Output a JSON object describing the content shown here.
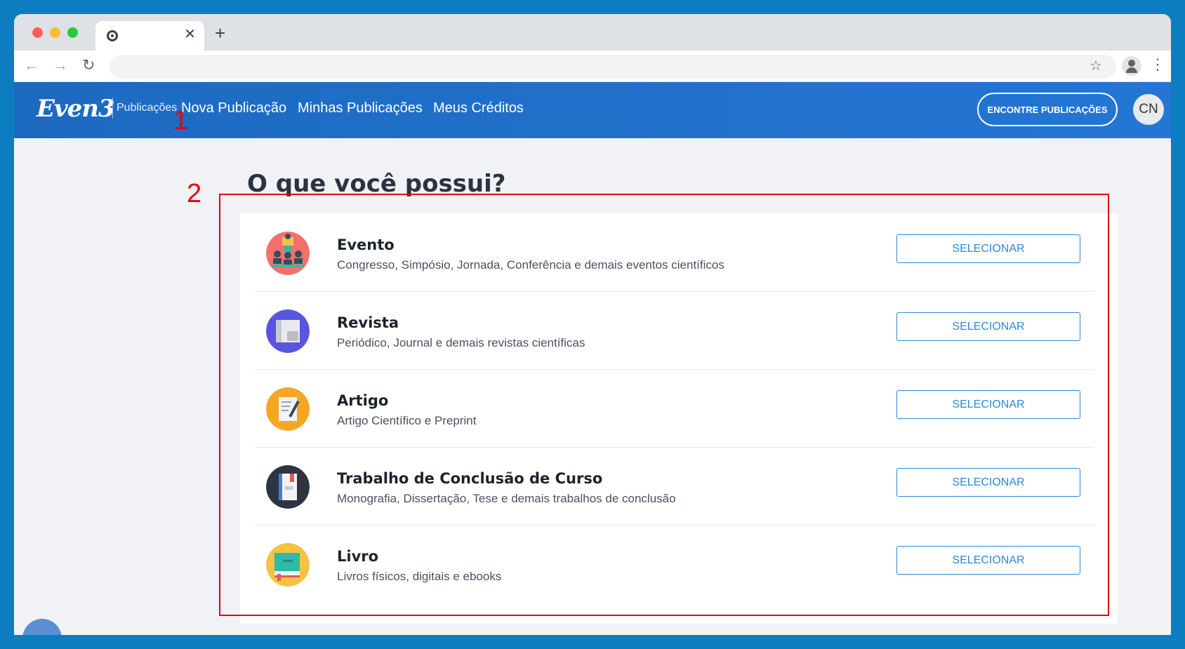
{
  "browser": {
    "tab_close": "✕",
    "new_tab": "+",
    "back": "←",
    "forward": "→",
    "reload": "↻",
    "address": "",
    "star": "☆",
    "menu": "⋮"
  },
  "header": {
    "brand": "Even3",
    "brand_sub": "Publicações",
    "nav": [
      "Nova Publicação",
      "Minhas Publicações",
      "Meus Créditos"
    ],
    "find_button": "ENCONTRE PUBLICAÇÕES",
    "avatar_initials": "CN"
  },
  "annotations": [
    "1",
    "2"
  ],
  "main": {
    "title": "O que você possui?",
    "options": [
      {
        "title": "Evento",
        "desc": "Congresso, Simpósio, Jornada, Conferência e demais eventos científicos",
        "button": "SELECIONAR",
        "icon": "event-icon"
      },
      {
        "title": "Revista",
        "desc": "Periódico, Journal e demais revistas científicas",
        "button": "SELECIONAR",
        "icon": "magazine-icon"
      },
      {
        "title": "Artigo",
        "desc": "Artigo Científico e Preprint",
        "button": "SELECIONAR",
        "icon": "article-icon"
      },
      {
        "title": "Trabalho de Conclusão de Curso",
        "desc": "Monografia, Dissertação, Tese e demais trabalhos de conclusão",
        "button": "SELECIONAR",
        "icon": "thesis-icon"
      },
      {
        "title": "Livro",
        "desc": "Livros físicos, digitais e ebooks",
        "button": "SELECIONAR",
        "icon": "book-icon"
      }
    ]
  },
  "colors": {
    "header_bg": "#1c6ac0",
    "accent": "#2c88d9",
    "annotation": "#e8000b"
  }
}
